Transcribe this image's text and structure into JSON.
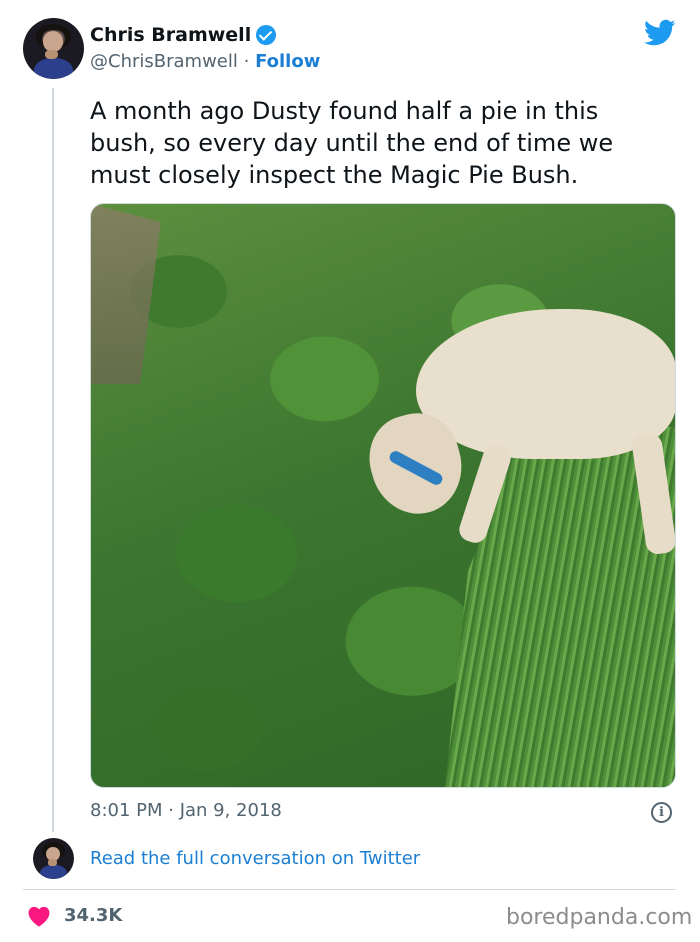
{
  "author": {
    "name": "Chris Bramwell",
    "handle": "@ChrisBramwell",
    "separator": "·",
    "follow_label": "Follow",
    "verified": true
  },
  "tweet": {
    "text": "A month ago Dusty found half a pie in this bush, so every day until the end of time we must closely inspect the Magic Pie Bush.",
    "timestamp": "8:01 PM · Jan 9, 2018"
  },
  "footer": {
    "read_conversation": "Read the full conversation on Twitter",
    "likes": "34.3K"
  },
  "watermark": "boredpanda.com",
  "colors": {
    "link": "#1d7fd4",
    "twitter_blue": "#1d9bf0",
    "heart": "#f91880",
    "muted": "#536471"
  },
  "icons": [
    "verified-badge-icon",
    "twitter-bird-icon",
    "info-icon",
    "heart-icon"
  ]
}
